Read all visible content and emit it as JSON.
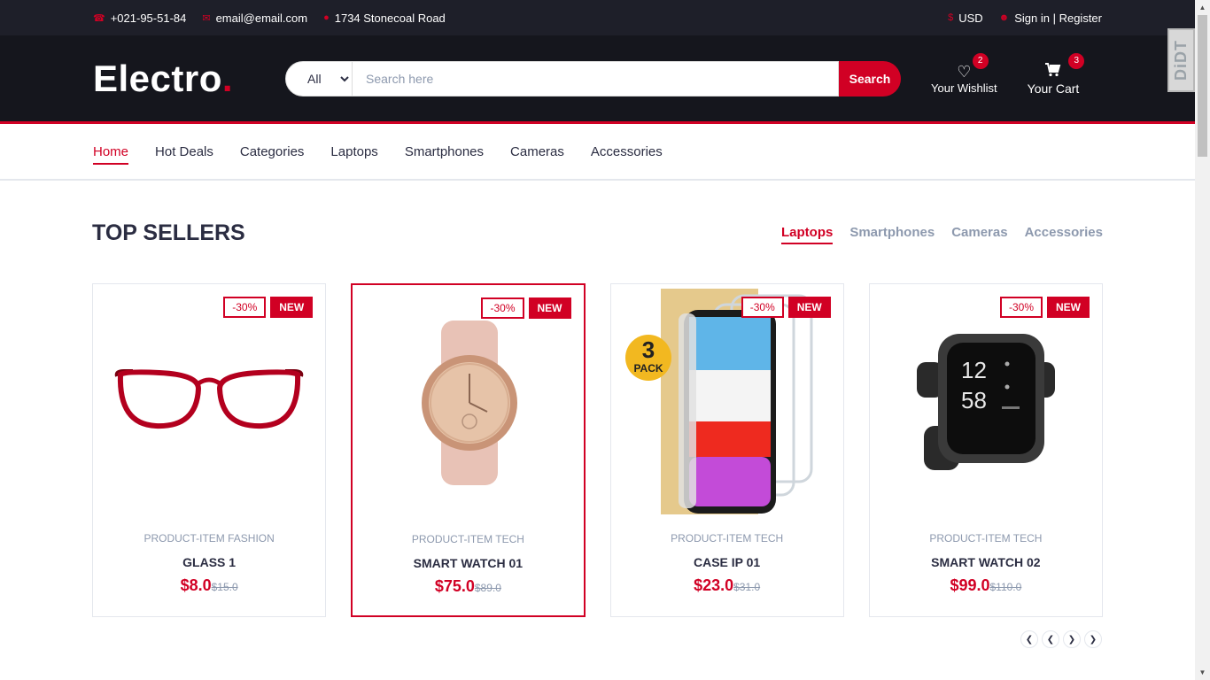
{
  "topbar": {
    "phone": "+021-95-51-84",
    "email": "email@email.com",
    "address": "1734 Stonecoal Road",
    "currency": "USD",
    "sign_in": "Sign in | Register"
  },
  "header": {
    "logo": "Electro",
    "logo_dot": ".",
    "search_category": "All",
    "search_placeholder": "Search here",
    "search_button": "Search",
    "wishlist_label": "Your Wishlist",
    "wishlist_qty": "2",
    "cart_label": "Your Cart",
    "cart_qty": "3"
  },
  "nav": {
    "items": [
      "Home",
      "Hot Deals",
      "Categories",
      "Laptops",
      "Smartphones",
      "Cameras",
      "Accessories"
    ]
  },
  "section": {
    "title": "TOP SELLERS",
    "tabs": [
      "Laptops",
      "Smartphones",
      "Cameras",
      "Accessories"
    ]
  },
  "products": [
    {
      "sale": "-30%",
      "new": "NEW",
      "category": "PRODUCT-ITEM FASHION",
      "name": "GLASS 1",
      "price": "$8.0",
      "old_price": "$15.0"
    },
    {
      "sale": "-30%",
      "new": "NEW",
      "category": "PRODUCT-ITEM TECH",
      "name": "SMART WATCH 01",
      "price": "$75.0",
      "old_price": "$89.0"
    },
    {
      "sale": "-30%",
      "new": "NEW",
      "category": "PRODUCT-ITEM TECH",
      "name": "CASE IP 01",
      "price": "$23.0",
      "old_price": "$31.0"
    },
    {
      "sale": "-30%",
      "new": "NEW",
      "category": "PRODUCT-ITEM TECH",
      "name": "SMART WATCH 02",
      "price": "$99.0",
      "old_price": "$110.0"
    }
  ],
  "extension_badge": "DiDT",
  "pack_badge": {
    "num": "3",
    "text": "PACK"
  },
  "watch_face": {
    "hour": "12",
    "minute": "58"
  },
  "colors": {
    "accent": "#D10024",
    "dark": "#15161d",
    "topbar": "#1e1f29",
    "muted": "#8d99ae"
  },
  "icons": {
    "phone": "phone-icon",
    "email": "envelope-icon",
    "address": "map-marker-icon",
    "currency": "dollar-icon",
    "user": "user-icon",
    "wishlist": "heart-icon",
    "cart": "cart-icon"
  }
}
